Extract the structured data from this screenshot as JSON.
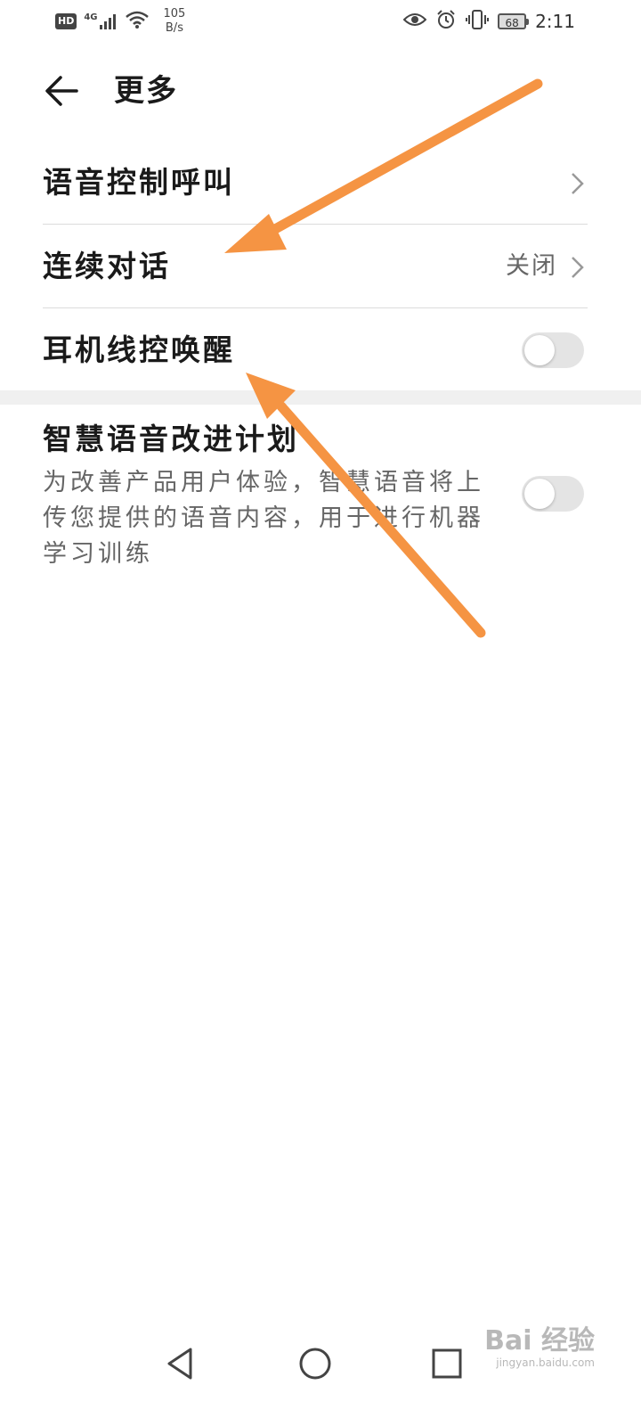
{
  "status_bar": {
    "hd_badge": "HD",
    "network_type": "4G",
    "net_speed_value": "105",
    "net_speed_unit": "B/s",
    "battery_level": "68",
    "time": "2:11",
    "icons": [
      "hd-icon",
      "signal-icon",
      "wifi-icon",
      "eye-icon",
      "alarm-icon",
      "vibrate-icon",
      "battery-icon"
    ]
  },
  "header": {
    "title": "更多"
  },
  "settings": {
    "items": [
      {
        "label": "语音控制呼叫",
        "value": "",
        "control": "chevron"
      },
      {
        "label": "连续对话",
        "value": "关闭",
        "control": "chevron"
      },
      {
        "label": "耳机线控唤醒",
        "value": "",
        "control": "toggle",
        "toggle_on": false
      }
    ]
  },
  "improvement": {
    "title": "智慧语音改进计划",
    "description": "为改善产品用户体验，智慧语音将上传您提供的语音内容，用于进行机器学习训练",
    "toggle_on": false
  },
  "annotation": {
    "arrow_color": "#F59443"
  },
  "watermark": {
    "main": "Bai 经验",
    "sub": "jingyan.baidu.com"
  },
  "nav": {
    "icons": [
      "back-triangle-icon",
      "home-circle-icon",
      "recents-square-icon"
    ]
  }
}
